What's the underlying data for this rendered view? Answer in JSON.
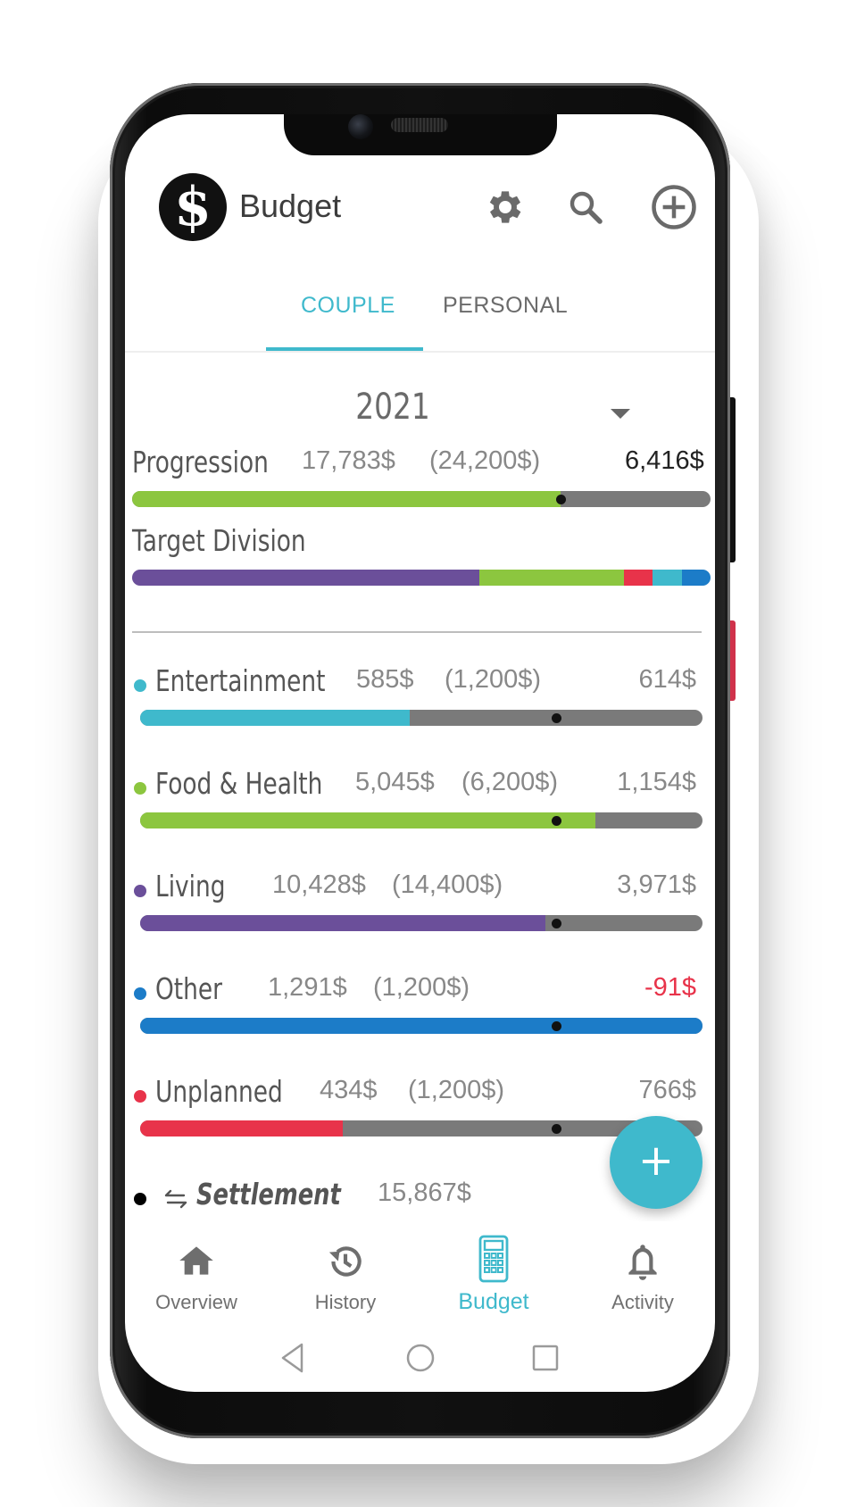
{
  "app": {
    "title": "Budget",
    "logo_symbol": "$"
  },
  "header_icons": [
    "gear-icon",
    "search-icon",
    "add-circle-icon"
  ],
  "tabs": [
    {
      "label": "COUPLE",
      "active": true
    },
    {
      "label": "PERSONAL",
      "active": false
    }
  ],
  "year_selector": {
    "value": "2021"
  },
  "progression": {
    "label": "Progression",
    "spent": "17,783$",
    "target": "(24,200$)",
    "remaining": "6,416$",
    "fill_fraction": 0.74,
    "marker_fraction": 0.74,
    "color": "#8cc63f"
  },
  "target_division": {
    "label": "Target Division",
    "segments": [
      {
        "name": "Living",
        "fraction": 0.6,
        "color": "#6b4f9a"
      },
      {
        "name": "Food & Health",
        "fraction": 0.25,
        "color": "#8cc63f"
      },
      {
        "name": "Unplanned",
        "fraction": 0.05,
        "color": "#e8334a"
      },
      {
        "name": "Entertainment",
        "fraction": 0.05,
        "color": "#3fb9cc"
      },
      {
        "name": "Other",
        "fraction": 0.05,
        "color": "#1c7cc8"
      }
    ]
  },
  "categories": [
    {
      "name": "Entertainment",
      "spent": "585$",
      "target": "(1,200$)",
      "remaining": "614$",
      "color": "#3fb9cc",
      "fill_fraction": 0.48,
      "marker_fraction": 0.74,
      "over": false
    },
    {
      "name": "Food & Health",
      "spent": "5,045$",
      "target": "(6,200$)",
      "remaining": "1,154$",
      "color": "#8cc63f",
      "fill_fraction": 0.81,
      "marker_fraction": 0.74,
      "over": false
    },
    {
      "name": "Living",
      "spent": "10,428$",
      "target": "(14,400$)",
      "remaining": "3,971$",
      "color": "#6b4f9a",
      "fill_fraction": 0.72,
      "marker_fraction": 0.74,
      "over": false
    },
    {
      "name": "Other",
      "spent": "1,291$",
      "target": "(1,200$)",
      "remaining": "-91$",
      "color": "#1c7cc8",
      "fill_fraction": 1.0,
      "marker_fraction": 0.74,
      "over": true
    },
    {
      "name": "Unplanned",
      "spent": "434$",
      "target": "(1,200$)",
      "remaining": "766$",
      "color": "#e8334a",
      "fill_fraction": 0.36,
      "marker_fraction": 0.74,
      "over": false
    }
  ],
  "settlement": {
    "label": "Settlement",
    "amount": "15,867$",
    "icon": "swap-arrows-icon",
    "color": "#000000"
  },
  "fab": {
    "label": "+"
  },
  "bottom_nav": [
    {
      "label": "Overview",
      "icon": "home-icon",
      "active": false
    },
    {
      "label": "History",
      "icon": "history-icon",
      "active": false
    },
    {
      "label": "Budget",
      "icon": "calculator-icon",
      "active": true
    },
    {
      "label": "Activity",
      "icon": "bell-icon",
      "active": false
    }
  ],
  "system_nav": [
    "back-icon",
    "home-circle-icon",
    "recents-icon"
  ],
  "colors": {
    "accent": "#3fb9cc",
    "negative": "#e8334a",
    "track": "#7a7a7a"
  }
}
